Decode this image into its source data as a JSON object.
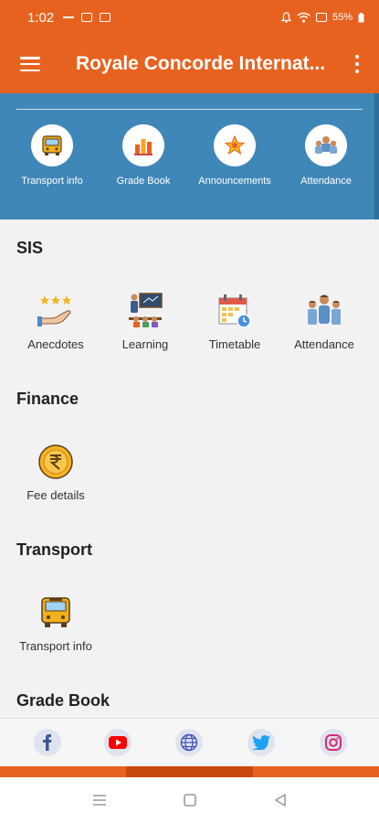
{
  "status_bar": {
    "time": "1:02",
    "battery": "55%"
  },
  "app_bar": {
    "title": "Royale Concorde Internat..."
  },
  "quick_links": [
    {
      "label": "Transport info",
      "icon": "bus-icon"
    },
    {
      "label": "Grade Book",
      "icon": "grade-book-icon"
    },
    {
      "label": "Announcements",
      "icon": "star-icon"
    },
    {
      "label": "Attendance",
      "icon": "students-icon"
    }
  ],
  "sections": {
    "sis": {
      "title": "SIS",
      "items": [
        {
          "label": "Anecdotes",
          "icon": "rating-hand-icon"
        },
        {
          "label": "Learning",
          "icon": "teacher-board-icon"
        },
        {
          "label": "Timetable",
          "icon": "calendar-clock-icon"
        },
        {
          "label": "Attendance",
          "icon": "students-icon"
        }
      ]
    },
    "finance": {
      "title": "Finance",
      "items": [
        {
          "label": "Fee details",
          "icon": "rupee-coin-icon"
        }
      ]
    },
    "transport": {
      "title": "Transport",
      "items": [
        {
          "label": "Transport info",
          "icon": "bus-icon"
        }
      ]
    },
    "grade_book": {
      "title": "Grade Book"
    }
  },
  "social_links": [
    {
      "name": "facebook-icon",
      "color": "#3b5998"
    },
    {
      "name": "youtube-icon",
      "color": "#ff0000"
    },
    {
      "name": "globe-icon",
      "color": "#3f51b5"
    },
    {
      "name": "twitter-icon",
      "color": "#1da1f2"
    },
    {
      "name": "instagram-icon",
      "color": "#d62976"
    }
  ],
  "colors": {
    "primary": "#e8621f",
    "quick_bar": "#3f87b9"
  }
}
